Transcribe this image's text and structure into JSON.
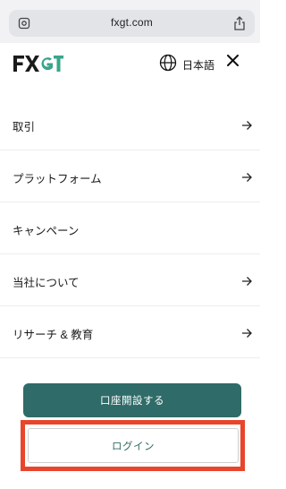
{
  "browser": {
    "url": "fxgt.com",
    "icons": {
      "left": "page-settings-icon",
      "right": "share-icon"
    }
  },
  "header": {
    "logo_text": "FXGT",
    "logo_colors": {
      "fx": "#1a1a1a",
      "gt": "#3aa58a"
    },
    "language_icon": "globe-icon",
    "language_label": "日本語",
    "close_icon": "close-icon"
  },
  "menu": {
    "items": [
      {
        "label": "取引",
        "arrow": true
      },
      {
        "label": "プラットフォーム",
        "arrow": true
      },
      {
        "label": "キャンペーン",
        "arrow": false
      },
      {
        "label": "当社について",
        "arrow": true
      },
      {
        "label": "リサーチ & 教育",
        "arrow": true
      }
    ]
  },
  "actions": {
    "open_account_label": "口座開設する",
    "login_label": "ログイン"
  },
  "colors": {
    "primary": "#2f6b68",
    "highlight": "#e8452c"
  }
}
